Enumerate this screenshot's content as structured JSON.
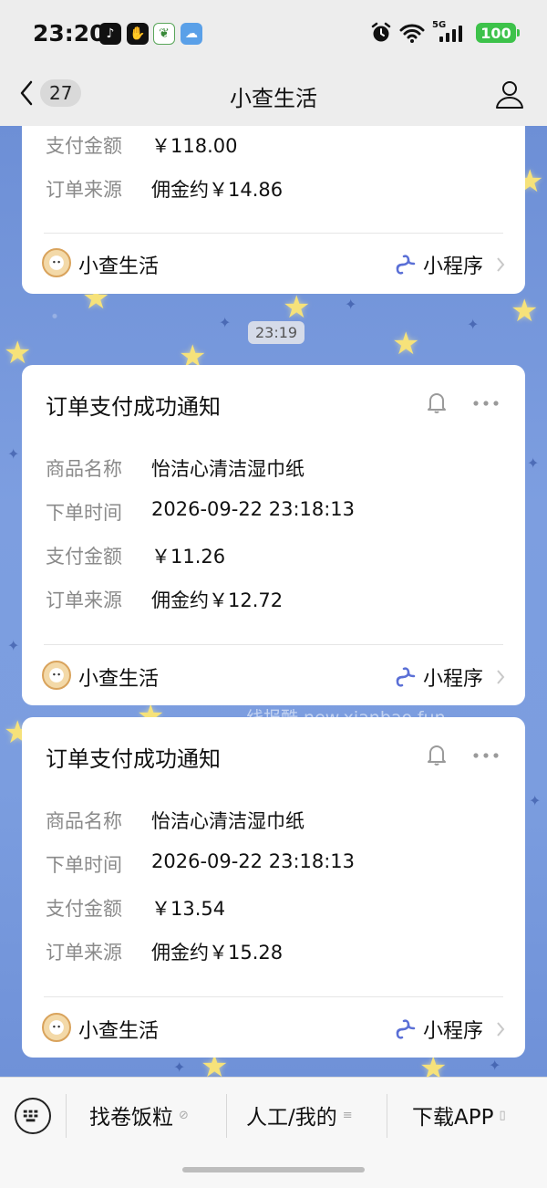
{
  "status_bar": {
    "time": "23:20",
    "network": "5G",
    "battery": "100",
    "icons": [
      "tiktok-icon",
      "hand-icon",
      "leaf-icon",
      "weather-icon",
      "alarm-icon",
      "wifi-icon",
      "signal-icon",
      "battery-icon"
    ]
  },
  "nav": {
    "unread_count": "27",
    "title": "小查生活"
  },
  "cards": [
    {
      "rows": [
        {
          "label": "支付金额",
          "value": "￥118.00"
        },
        {
          "label": "订单来源",
          "value": "佣金约￥14.86"
        }
      ],
      "footer_name": "小查生活",
      "mini_program_label": "小程序"
    },
    {
      "title": "订单支付成功通知",
      "rows": [
        {
          "label": "商品名称",
          "value": "怡洁心清洁湿巾纸"
        },
        {
          "label": "下单时间",
          "value": "2026-09-22 23:18:13"
        },
        {
          "label": "支付金额",
          "value": "￥11.26"
        },
        {
          "label": "订单来源",
          "value": "佣金约￥12.72"
        }
      ],
      "footer_name": "小查生活",
      "mini_program_label": "小程序"
    },
    {
      "title": "订单支付成功通知",
      "rows": [
        {
          "label": "商品名称",
          "value": "怡洁心清洁湿巾纸"
        },
        {
          "label": "下单时间",
          "value": "2026-09-22 23:18:13"
        },
        {
          "label": "支付金额",
          "value": "￥13.54"
        },
        {
          "label": "订单来源",
          "value": "佣金约￥15.28"
        }
      ],
      "footer_name": "小查生活",
      "mini_program_label": "小程序"
    }
  ],
  "timestamp": "23:19",
  "watermark": "线报酷 new.xianbao.fun",
  "bottom_menu": {
    "items": [
      "找卷饭粒",
      "人工/我的",
      "下载APP"
    ]
  },
  "colors": {
    "chat_background": "#7b9ddf",
    "battery": "#3dc24a",
    "star": "#f6e27a"
  }
}
